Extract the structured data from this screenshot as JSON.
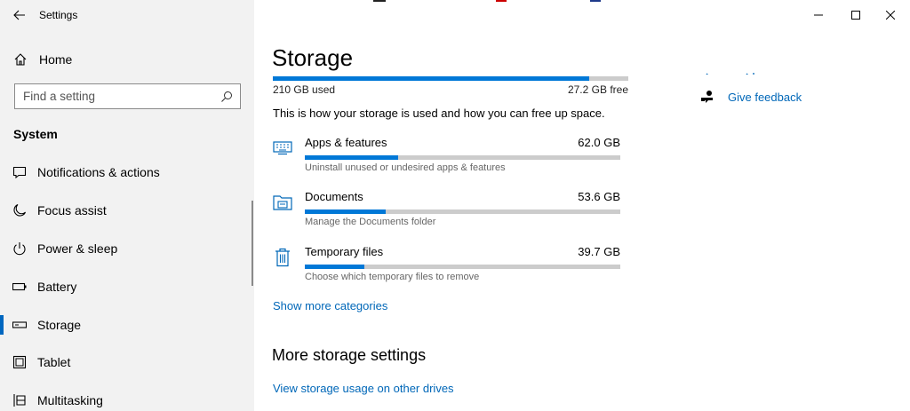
{
  "window": {
    "title": "Settings",
    "controls": {
      "minimize": "minimize-icon",
      "maximize": "maximize-icon",
      "close": "close-icon"
    }
  },
  "sidebar": {
    "home_label": "Home",
    "search_placeholder": "Find a setting",
    "section_title": "System",
    "items": [
      {
        "label": "Notifications & actions",
        "icon": "notification-icon"
      },
      {
        "label": "Focus assist",
        "icon": "moon-icon"
      },
      {
        "label": "Power & sleep",
        "icon": "power-icon"
      },
      {
        "label": "Battery",
        "icon": "battery-icon"
      },
      {
        "label": "Storage",
        "icon": "storage-icon",
        "active": true
      },
      {
        "label": "Tablet",
        "icon": "tablet-icon"
      },
      {
        "label": "Multitasking",
        "icon": "multitasking-icon"
      }
    ]
  },
  "main": {
    "title": "Storage",
    "used": "210 GB used",
    "free": "27.2 GB free",
    "used_fraction": 0.89,
    "intro": "This is how your storage is used and how you can free up space.",
    "categories": [
      {
        "name": "Apps & features",
        "size": "62.0 GB",
        "desc": "Uninstall unused or undesired apps & features",
        "fraction": 0.295,
        "icon": "keyboard-icon"
      },
      {
        "name": "Documents",
        "size": "53.6 GB",
        "desc": "Manage the Documents folder",
        "fraction": 0.255,
        "icon": "documents-folder-icon"
      },
      {
        "name": "Temporary files",
        "size": "39.7 GB",
        "desc": "Choose which temporary files to remove",
        "fraction": 0.19,
        "icon": "trash-icon"
      }
    ],
    "show_more": "Show more categories",
    "more_heading": "More storage settings",
    "other_drives_link": "View storage usage on other drives"
  },
  "side_links": {
    "feedback": "Give feedback"
  },
  "colors": {
    "accent": "#0078d7",
    "link": "#0067b8",
    "sidebar_bg": "#f2f2f2",
    "bar_track": "#cccccc"
  }
}
